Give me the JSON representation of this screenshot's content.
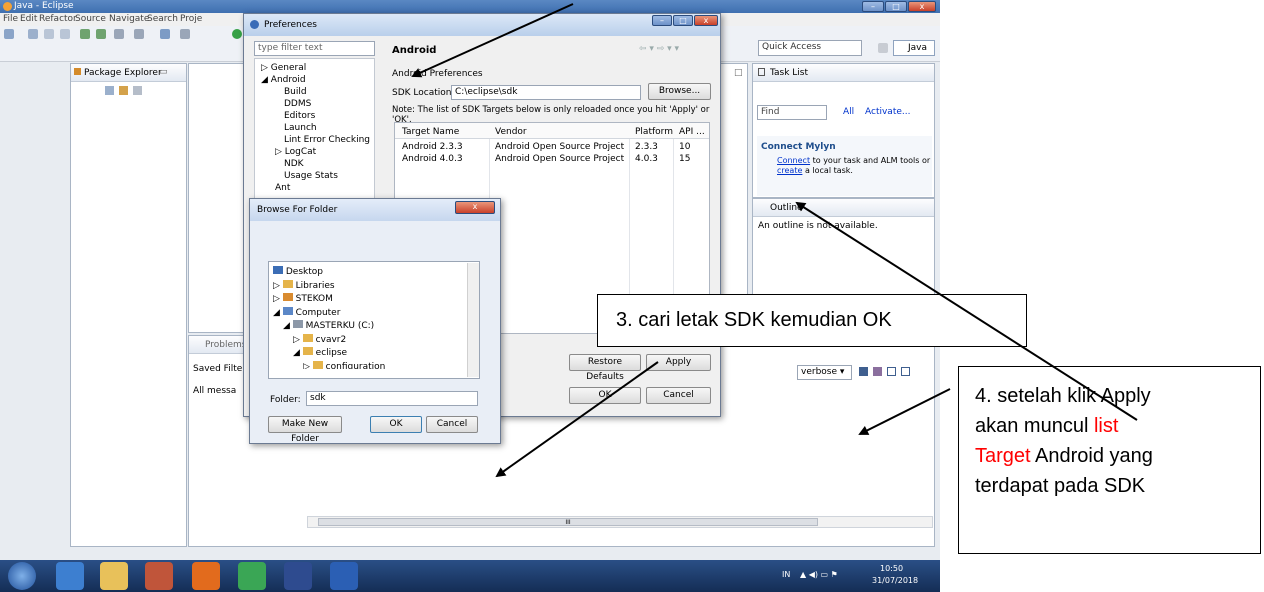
{
  "window": {
    "title": "Java - Eclipse"
  },
  "menubar": [
    "File",
    "Edit",
    "Refactor",
    "Source",
    "Navigate",
    "Search",
    "Proje"
  ],
  "quick_access": "Quick Access",
  "perspective": "Java",
  "package_explorer": {
    "title": "Package Explorer"
  },
  "task_list": {
    "title": "Task List",
    "find": "Find",
    "all": "All",
    "activate": "Activate..."
  },
  "mylyn": {
    "title": "Connect Mylyn",
    "text_link": "Connect",
    "text_rest": "to your task and ALM tools or",
    "text_link2": "create",
    "text_end": "a local task."
  },
  "outline": {
    "title": "Outline",
    "message": "An outline is not available."
  },
  "problems": {
    "title": "Problems",
    "saved_filter": "Saved Filte",
    "all_messages": "All messa"
  },
  "logcat": {
    "verbose": "verbose"
  },
  "preferences": {
    "title": "Preferences",
    "filter_placeholder": "type filter text",
    "tree": [
      "General",
      "Android",
      "Build",
      "DDMS",
      "Editors",
      "Launch",
      "Lint Error Checking",
      "LogCat",
      "NDK",
      "Usage Stats",
      "Ant"
    ],
    "page_title": "Android",
    "section": "Android Preferences",
    "sdk_label": "SDK Location:",
    "sdk_value": "C:\\eclipse\\sdk",
    "browse": "Browse...",
    "note": "Note: The list of SDK Targets below is only reloaded once you hit 'Apply' or 'OK'.",
    "columns": [
      "Target Name",
      "Vendor",
      "Platform",
      "API ..."
    ],
    "rows": [
      [
        "Android 2.3.3",
        "Android Open Source Project",
        "2.3.3",
        "10"
      ],
      [
        "Android 4.0.3",
        "Android Open Source Project",
        "4.0.3",
        "15"
      ]
    ],
    "restore_defaults": "Restore Defaults",
    "apply": "Apply",
    "ok": "OK",
    "cancel": "Cancel"
  },
  "browse_folder": {
    "title": "Browse For Folder",
    "tree": [
      "Desktop",
      "Libraries",
      "STEKOM",
      "Computer",
      "MASTERKU (C:)",
      "cvavr2",
      "eclipse",
      "configuration"
    ],
    "folder_label": "Folder:",
    "folder_value": "sdk",
    "make_new_folder": "Make New Folder",
    "ok": "OK",
    "cancel": "Cancel",
    "close": "x"
  },
  "scrollbar_mark": "III",
  "tray": {
    "lang": "IN",
    "time": "10:50",
    "date": "31/07/2018"
  },
  "annotations": {
    "note3": "3. cari letak SDK kemudian OK",
    "note4_a": "4. setelah klik Apply",
    "note4_b": "akan muncul",
    "note4_red1": "list",
    "note4_red2": "Target",
    "note4_c": "Android yang",
    "note4_d": "terdapat pada SDK"
  },
  "colors": {
    "note_red": "#ff0000",
    "title_blue": "#3f6fb0",
    "link_blue": "#0033cc"
  }
}
